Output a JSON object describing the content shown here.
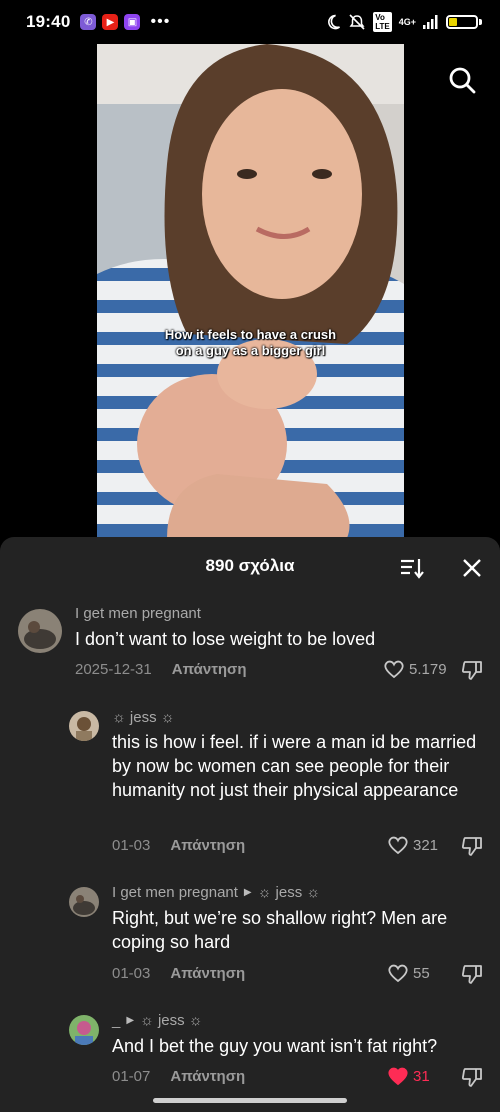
{
  "status": {
    "time": "19:40",
    "battery": "30",
    "battery_level": 0.3,
    "network": "4G+",
    "volte": "VoLTE"
  },
  "video": {
    "caption_line1": "How it feels to have a crush",
    "caption_line2": "on a guy as a bigger girl"
  },
  "sheet": {
    "title": "890 σχόλια"
  },
  "comments": [
    {
      "user": "I get men pregnant",
      "text": "I don’t want to lose weight to be loved",
      "date": "2025-12-31",
      "reply_label": "Απάντηση",
      "likes": "5.179",
      "liked": false
    },
    {
      "user": "☼ jess ☼",
      "text": "this is how i feel. if i were a man id be married by now bc women can see people for their humanity not just their physical appearance",
      "date": "01-03",
      "reply_label": "Απάντηση",
      "likes": "321",
      "liked": false
    },
    {
      "user": "I get men pregnant",
      "reply_to": "☼ jess ☼",
      "text": "Right, but we’re so shallow right? Men are coping so hard",
      "date": "01-03",
      "reply_label": "Απάντηση",
      "likes": "55",
      "liked": false
    },
    {
      "user": "_",
      "reply_to": "☼ jess ☼",
      "text": "And I bet the guy you want isn’t fat right?",
      "date": "01-07",
      "reply_label": "Απάντηση",
      "likes": "31",
      "liked": true
    }
  ],
  "colors": {
    "sheet_bg": "#232323",
    "liked_heart": "#fe2c55",
    "muted_text": "#a9a9a9"
  }
}
